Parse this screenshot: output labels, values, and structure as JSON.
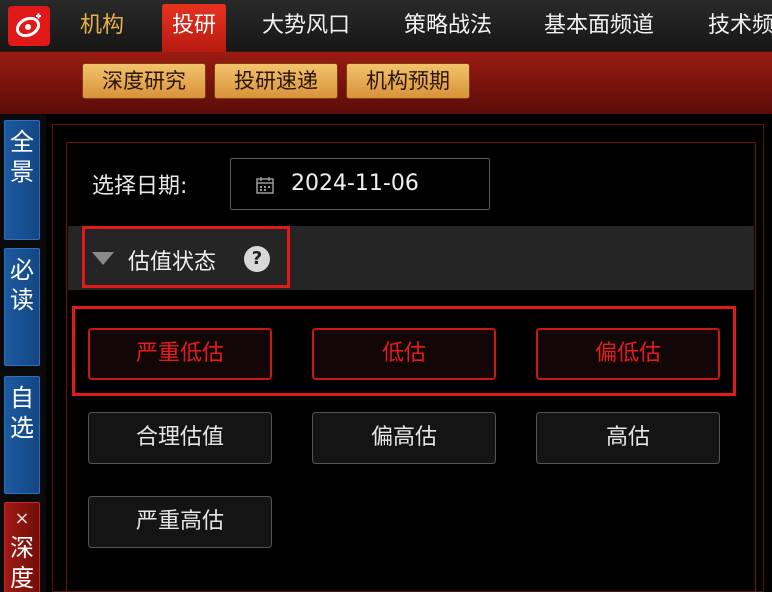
{
  "nav": {
    "tabs": [
      "机构",
      "投研",
      "大势风口",
      "策略战法",
      "基本面频道",
      "技术频"
    ],
    "active": "投研"
  },
  "subnav": {
    "buttons": [
      "深度研究",
      "投研速递",
      "机构预期"
    ]
  },
  "rail": {
    "items": [
      {
        "label": "全\n景"
      },
      {
        "label": "必\n读"
      },
      {
        "label": "自\n选"
      },
      {
        "label": "深\n度",
        "close": "×"
      }
    ]
  },
  "filter": {
    "date_label": "选择日期:",
    "date_value": "2024-11-06"
  },
  "section": {
    "title": "估值状态",
    "help": "?"
  },
  "options": {
    "row1": [
      "严重低估",
      "低估",
      "偏低估"
    ],
    "row2": [
      "合理估值",
      "偏高估",
      "高估"
    ],
    "row3": [
      "严重高估"
    ]
  },
  "colors": {
    "accent_red": "#e21a1a",
    "tab_gold": "#e8b04a",
    "rail_blue": "#1d5aa0"
  }
}
